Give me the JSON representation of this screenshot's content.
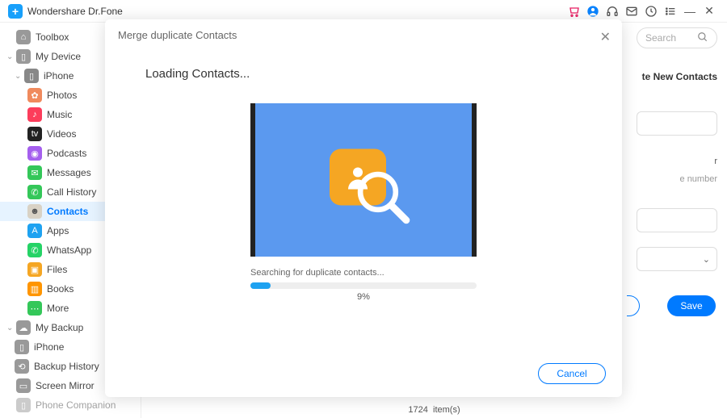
{
  "titlebar": {
    "title": "Wondershare Dr.Fone"
  },
  "sidebar": {
    "toolbox": "Toolbox",
    "mydevice": "My Device",
    "iphone": "iPhone",
    "items": [
      {
        "label": "Photos",
        "color": "#f08a5d"
      },
      {
        "label": "Music",
        "color": "#fc3d5b"
      },
      {
        "label": "Videos",
        "color": "#222"
      },
      {
        "label": "Podcasts",
        "color": "#a55fee"
      },
      {
        "label": "Messages",
        "color": "#34c759"
      },
      {
        "label": "Call History",
        "color": "#34c759"
      },
      {
        "label": "Contacts",
        "color": "#d9d2c5"
      },
      {
        "label": "Apps",
        "color": "#1ea2f1"
      },
      {
        "label": "WhatsApp",
        "color": "#25d366"
      },
      {
        "label": "Files",
        "color": "#f5a623"
      },
      {
        "label": "Books",
        "color": "#ff9500"
      },
      {
        "label": "More",
        "color": "#34c759"
      }
    ],
    "mybackup": "My Backup",
    "backup_iphone": "iPhone",
    "backup_history": "Backup History",
    "screen_mirror": "Screen Mirror",
    "phone_companion": "Phone Companion"
  },
  "search": {
    "placeholder": "Search"
  },
  "newcontacts": {
    "title": "te New Contacts"
  },
  "fields": {
    "f1": "",
    "f2": "r",
    "f3": "e number",
    "f4": "",
    "f5": ""
  },
  "buttons": {
    "save": "Save",
    "cancel": "Cancel"
  },
  "status": {
    "count": "1724",
    "label": "item(s)"
  },
  "modal": {
    "title": "Merge duplicate Contacts",
    "heading": "Loading Contacts...",
    "searching": "Searching for duplicate contacts...",
    "percent": "9%",
    "cancel": "Cancel"
  }
}
